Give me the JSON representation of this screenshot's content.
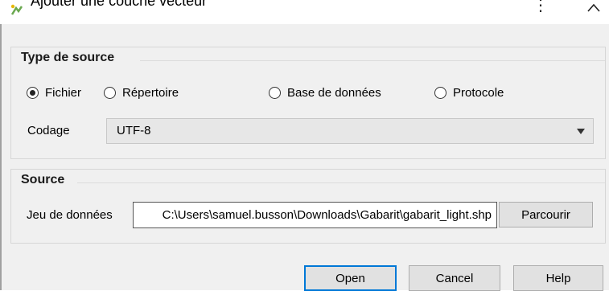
{
  "window": {
    "title": "Ajouter une couche vecteur",
    "more_glyph": "⋮"
  },
  "source_type": {
    "group_title": "Type de source",
    "options": [
      {
        "label": "Fichier",
        "checked": true
      },
      {
        "label": "Répertoire",
        "checked": false
      },
      {
        "label": "Base de données",
        "checked": false
      },
      {
        "label": "Protocole",
        "checked": false
      }
    ],
    "encoding_label": "Codage",
    "encoding_value": "UTF-8"
  },
  "source": {
    "group_title": "Source",
    "dataset_label": "Jeu de données",
    "dataset_value": "C:\\Users\\samuel.busson\\Downloads\\Gabarit\\gabarit_light.shp",
    "browse_label": "Parcourir"
  },
  "buttons": {
    "open": "Open",
    "cancel": "Cancel",
    "help": "Help"
  },
  "colors": {
    "focus_border": "#0078d7",
    "dialog_bg": "#f0f0f0"
  }
}
